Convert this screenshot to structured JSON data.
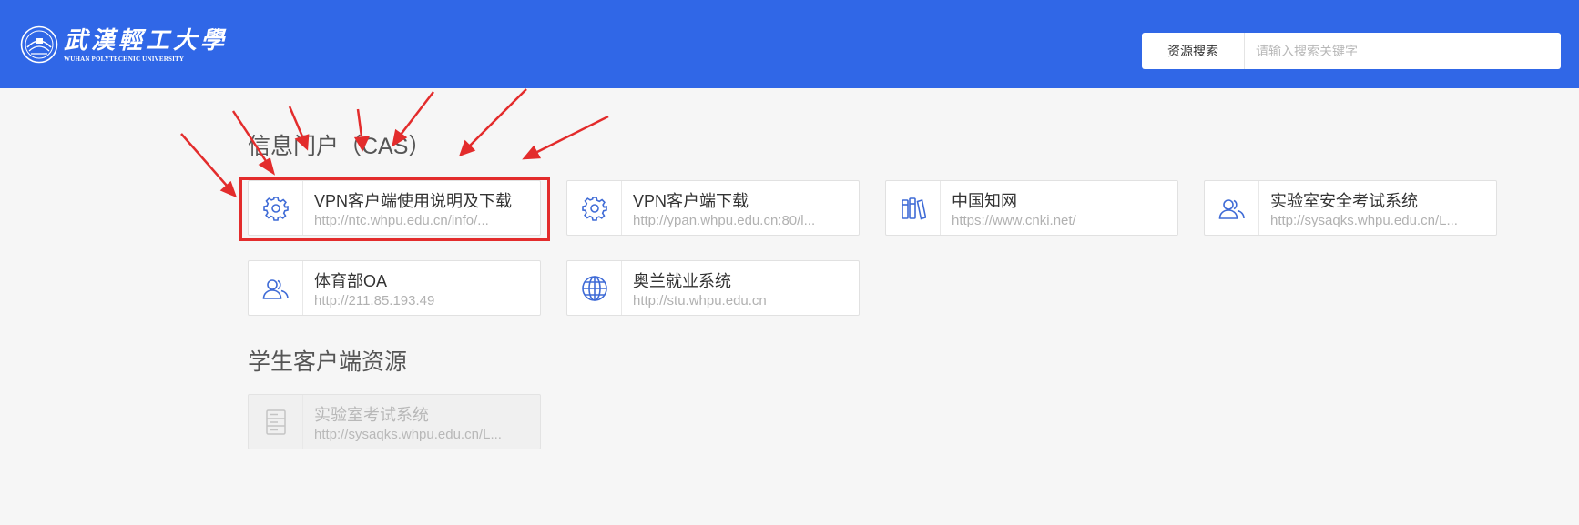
{
  "header": {
    "logo_cn": "武漢輕工大學",
    "logo_en": "WUHAN POLYTECHNIC UNIVERSITY",
    "search_button": "资源搜索",
    "search_placeholder": "请输入搜索关键字"
  },
  "sections": [
    {
      "title": "信息门户（CAS）",
      "cards": [
        {
          "name": "VPN客户端使用说明及下载",
          "url": "http://ntc.whpu.edu.cn/info/...",
          "icon": "gear-icon"
        },
        {
          "name": "VPN客户端下载",
          "url": "http://ypan.whpu.edu.cn:80/l...",
          "icon": "gear-icon"
        },
        {
          "name": "中国知网",
          "url": "https://www.cnki.net/",
          "icon": "books-icon"
        },
        {
          "name": "实验室安全考试系统",
          "url": "http://sysaqks.whpu.edu.cn/L...",
          "icon": "users-icon"
        },
        {
          "name": "体育部OA",
          "url": "http://211.85.193.49",
          "icon": "users-icon"
        },
        {
          "name": "奥兰就业系统",
          "url": "http://stu.whpu.edu.cn",
          "icon": "globe-icon"
        }
      ]
    },
    {
      "title": "学生客户端资源",
      "cards": [
        {
          "name": "实验室考试系统",
          "url": "http://sysaqks.whpu.edu.cn/L...",
          "icon": "server-icon"
        }
      ]
    }
  ],
  "colors": {
    "header_bg": "#3067e7",
    "icon_blue": "#3f6bd6",
    "highlight": "#e32c2c",
    "page_bg": "#f6f6f6"
  }
}
